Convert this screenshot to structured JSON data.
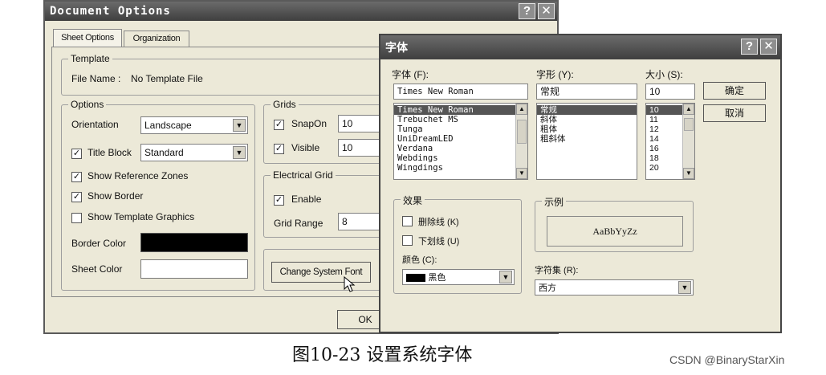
{
  "doc_dialog": {
    "title": "Document Options",
    "help_btn": "?",
    "close_btn": "✕",
    "tabs": [
      "Sheet Options",
      "Organization"
    ],
    "template": {
      "group_label": "Template",
      "file_name_label": "File Name :",
      "file_name_value": "No Template File"
    },
    "options": {
      "group_label": "Options",
      "orientation_label": "Orientation",
      "orientation_value": "Landscape",
      "title_block_label": "Title Block",
      "title_block_value": "Standard",
      "show_reference_zones": "Show Reference Zones",
      "show_border": "Show Border",
      "show_template_graphics": "Show Template Graphics",
      "border_color_label": "Border Color",
      "sheet_color_label": "Sheet Color"
    },
    "grids": {
      "group_label": "Grids",
      "snap_on_label": "SnapOn",
      "snap_on_value": "10",
      "visible_label": "Visible",
      "visible_value": "10"
    },
    "electrical_grid": {
      "group_label": "Electrical Grid",
      "enable_label": "Enable",
      "grid_range_label": "Grid Range",
      "grid_range_value": "8"
    },
    "change_font_button": "Change System Font",
    "ok_button": "OK"
  },
  "font_dialog": {
    "title": "字体",
    "help_btn": "?",
    "close_btn": "✕",
    "font_label": "字体 (F):",
    "font_value": "Times New Roman",
    "font_list": [
      "Times New Roman",
      "Trebuchet MS",
      "Tunga",
      "UniDreamLED",
      "Verdana",
      "Webdings",
      "Wingdings"
    ],
    "style_label": "字形 (Y):",
    "style_value": "常规",
    "style_list": [
      "常规",
      "斜体",
      "粗体",
      "粗斜体"
    ],
    "size_label": "大小 (S):",
    "size_value": "10",
    "size_list": [
      "10",
      "11",
      "12",
      "14",
      "16",
      "18",
      "20"
    ],
    "ok_button": "确定",
    "cancel_button": "取消",
    "effects_label": "效果",
    "strikeout_label": "删除线 (K)",
    "underline_label": "下划线 (U)",
    "color_label": "颜色 (C):",
    "color_value": "黑色",
    "sample_label": "示例",
    "sample_text": "AaBbYyZz",
    "script_label": "字符集 (R):",
    "script_value": "西方"
  },
  "caption": "图10-23  设置系统字体",
  "watermark": "CSDN @BinaryStarXin",
  "colors": {
    "border_color_swatch": "#000000",
    "sheet_color_swatch": "#ffffff",
    "font_color_swatch": "#000000"
  }
}
